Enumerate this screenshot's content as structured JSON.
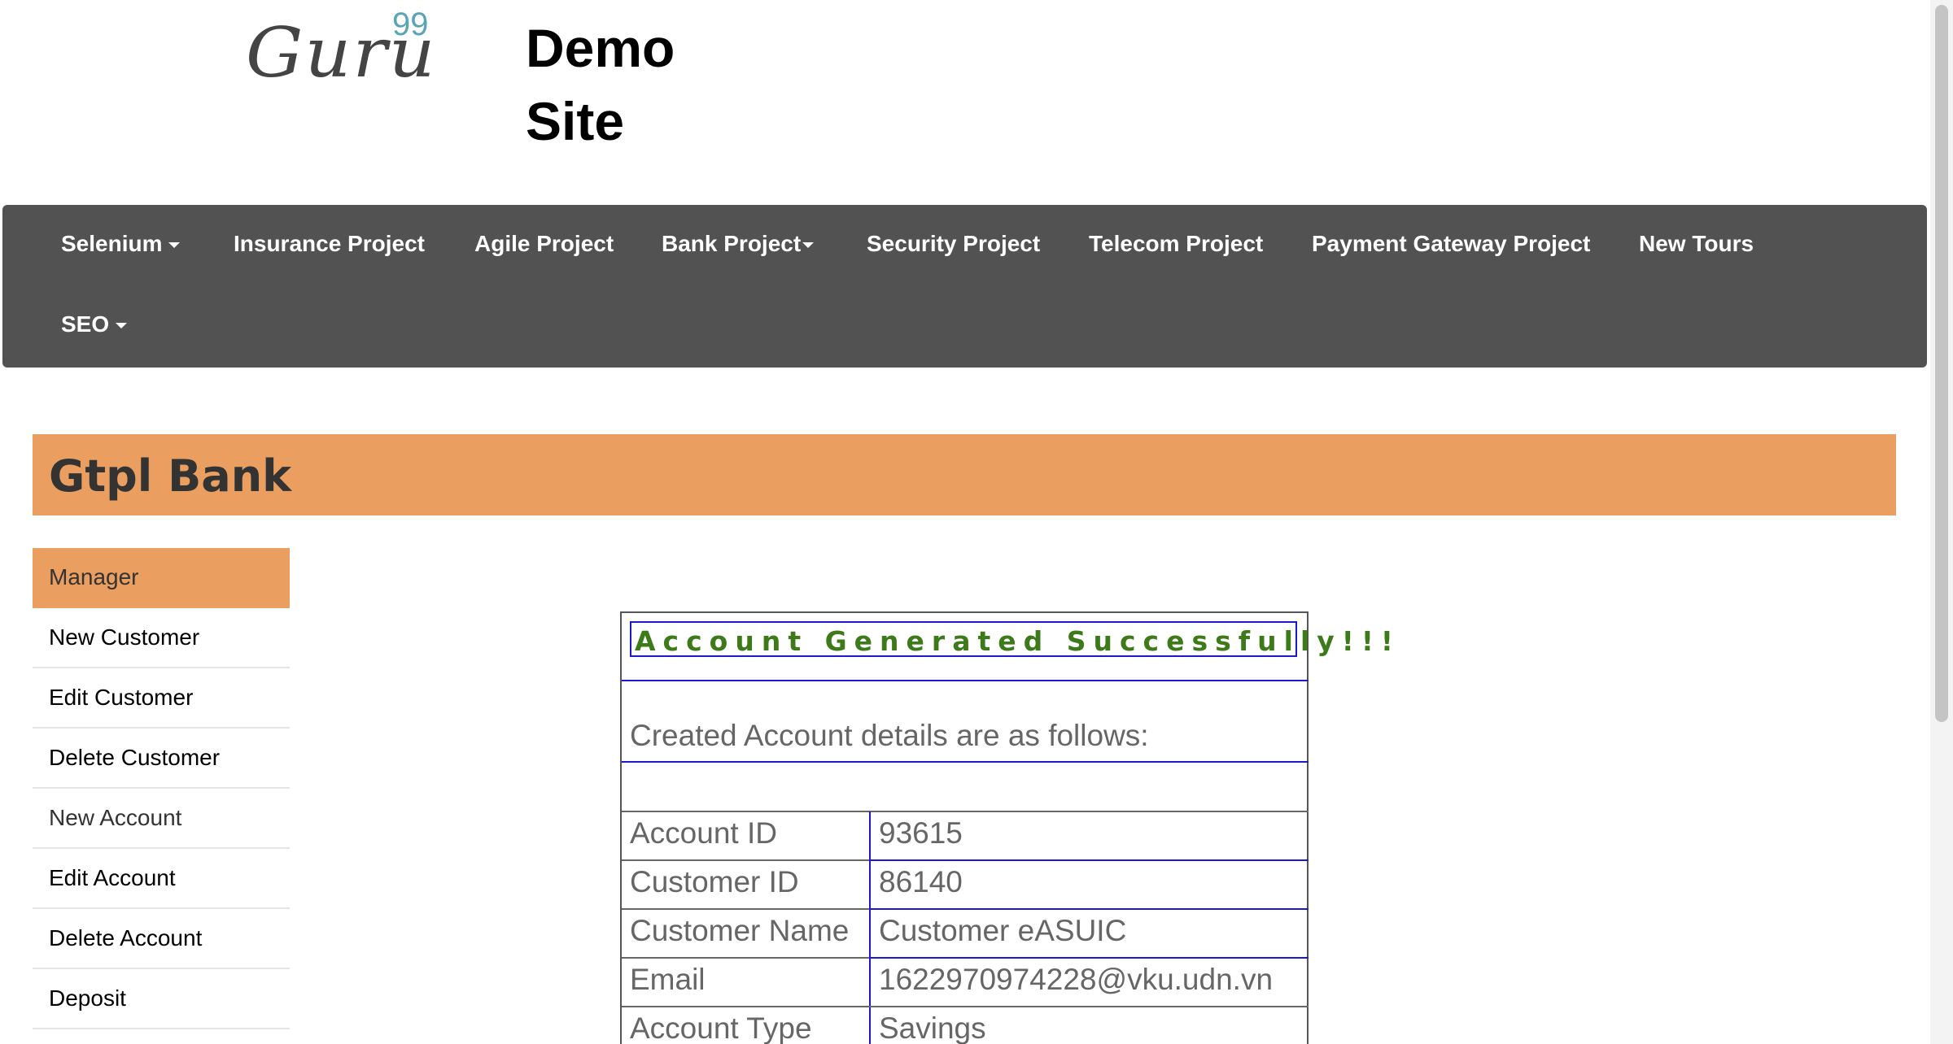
{
  "header": {
    "logo_word": "Guru",
    "logo_sup": "99",
    "site_title_line1": "Demo",
    "site_title_line2": "Site"
  },
  "navbar": {
    "items": [
      {
        "label": "Selenium",
        "dropdown": true
      },
      {
        "label": "Insurance Project",
        "dropdown": false
      },
      {
        "label": "Agile Project",
        "dropdown": false
      },
      {
        "label": "Bank Project",
        "dropdown": true
      },
      {
        "label": "Security Project",
        "dropdown": false
      },
      {
        "label": "Telecom Project",
        "dropdown": false
      },
      {
        "label": "Payment Gateway Project",
        "dropdown": false
      },
      {
        "label": "New Tours",
        "dropdown": false
      },
      {
        "label": "SEO",
        "dropdown": true
      }
    ]
  },
  "bank": {
    "title": "Gtpl Bank"
  },
  "sidebar": {
    "items": [
      {
        "label": "Manager"
      },
      {
        "label": "New Customer"
      },
      {
        "label": "Edit Customer"
      },
      {
        "label": "Delete Customer"
      },
      {
        "label": "New Account"
      },
      {
        "label": "Edit Account"
      },
      {
        "label": "Delete Account"
      },
      {
        "label": "Deposit"
      }
    ]
  },
  "account": {
    "success_message": "Account Generated Successfully!!!",
    "details_heading": "Created Account details are as follows:",
    "rows": [
      {
        "label": "Account ID",
        "value": "93615"
      },
      {
        "label": "Customer ID",
        "value": "86140"
      },
      {
        "label": "Customer Name",
        "value": "Customer eASUIC"
      },
      {
        "label": "Email",
        "value": "1622970974228@vku.udn.vn"
      },
      {
        "label": "Account Type",
        "value": "Savings"
      }
    ]
  },
  "colors": {
    "navbar_bg": "#525252",
    "accent_orange": "#ea9e5f",
    "success_green": "#3d7a1a",
    "table_blue": "#1a1acc"
  }
}
